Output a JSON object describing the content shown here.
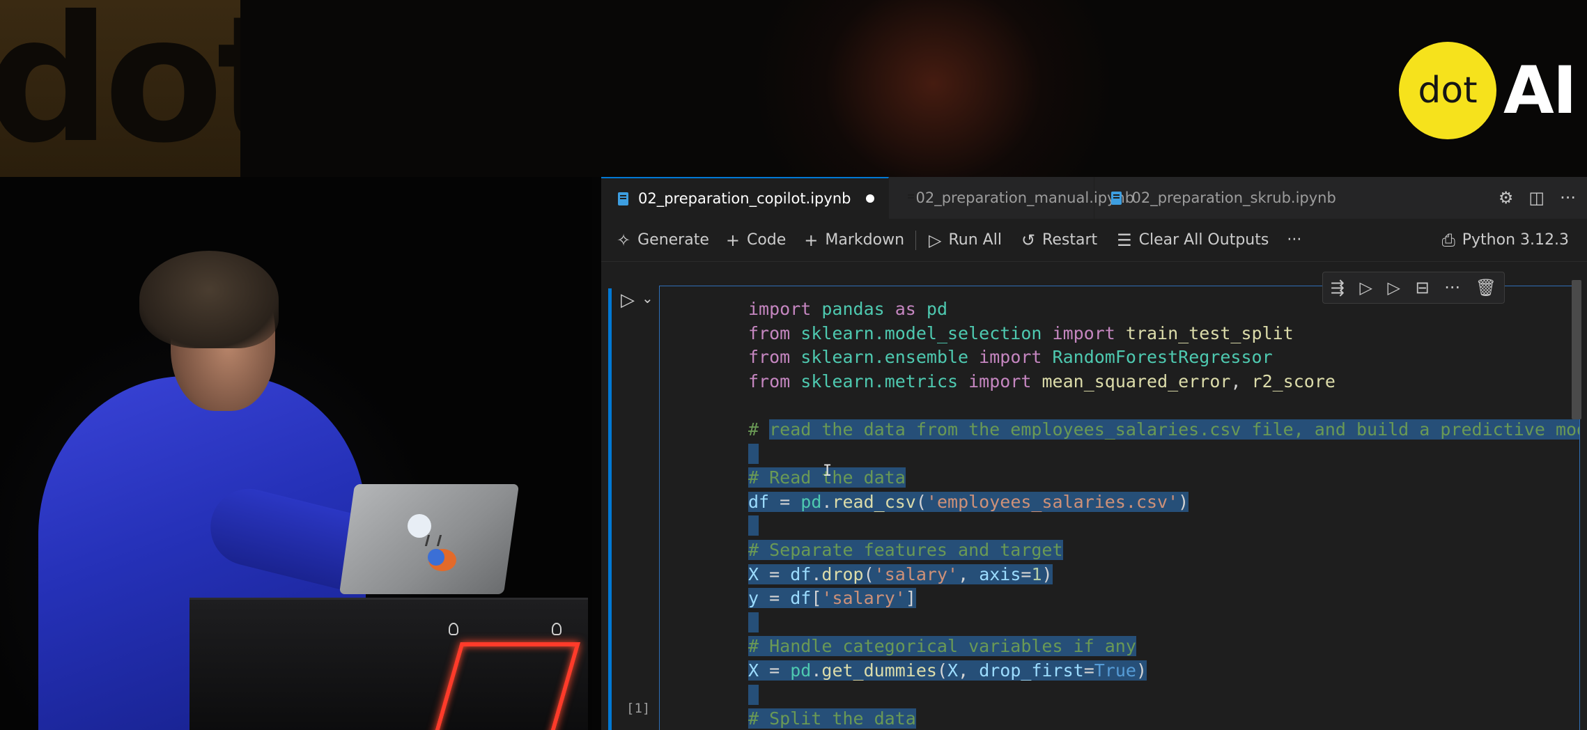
{
  "logo": {
    "circle_text": "dot",
    "text": "AI"
  },
  "banner": {
    "text": "dot"
  },
  "tabs": [
    {
      "label": "02_preparation_copilot.ipynb",
      "active": true,
      "modified": true
    },
    {
      "label": "02_preparation_manual.ipynb",
      "active": false
    },
    {
      "label": "02_preparation_skrub.ipynb",
      "active": false
    }
  ],
  "tab_actions": {
    "settings": "⚙",
    "split": "◫",
    "more": "···"
  },
  "toolbar": {
    "generate": "Generate",
    "code": "Code",
    "markdown": "Markdown",
    "run_all": "Run All",
    "restart": "Restart",
    "clear_outputs": "Clear All Outputs",
    "more": "···",
    "kernel": "Python 3.12.3"
  },
  "cell": {
    "execution_count": "[1]"
  },
  "colors": {
    "accent": "#0078d4",
    "logo_yellow": "#f6e21c",
    "selection": "#264f78"
  }
}
